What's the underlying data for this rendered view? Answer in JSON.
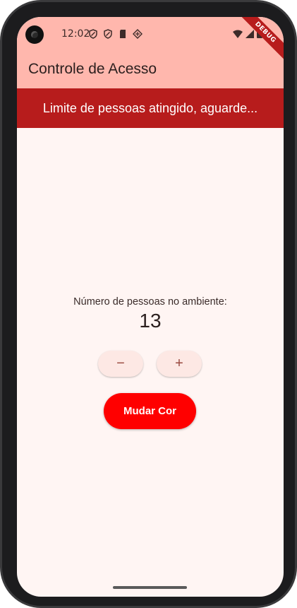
{
  "status_bar": {
    "time": "12:02",
    "left_icons": [
      "shield-icon",
      "shield-icon",
      "sd-card-icon",
      "diamond-icon"
    ],
    "right_icons": [
      "wifi-icon",
      "signal-icon",
      "battery-icon"
    ],
    "debug_label": "DEBUG"
  },
  "app_bar": {
    "title": "Controle de Acesso",
    "background": "#ffb7ad"
  },
  "alert": {
    "message": "Limite de pessoas atingido, aguarde...",
    "background": "#b71c1c"
  },
  "counter": {
    "label": "Número de pessoas no ambiente:",
    "value": "13",
    "decrement_label": "−",
    "increment_label": "+"
  },
  "actions": {
    "change_color_label": "Mudar Cor",
    "change_color_bg": "#ff0000"
  },
  "colors": {
    "page_bg": "#fff5f3",
    "button_bg": "#fde8e4"
  }
}
